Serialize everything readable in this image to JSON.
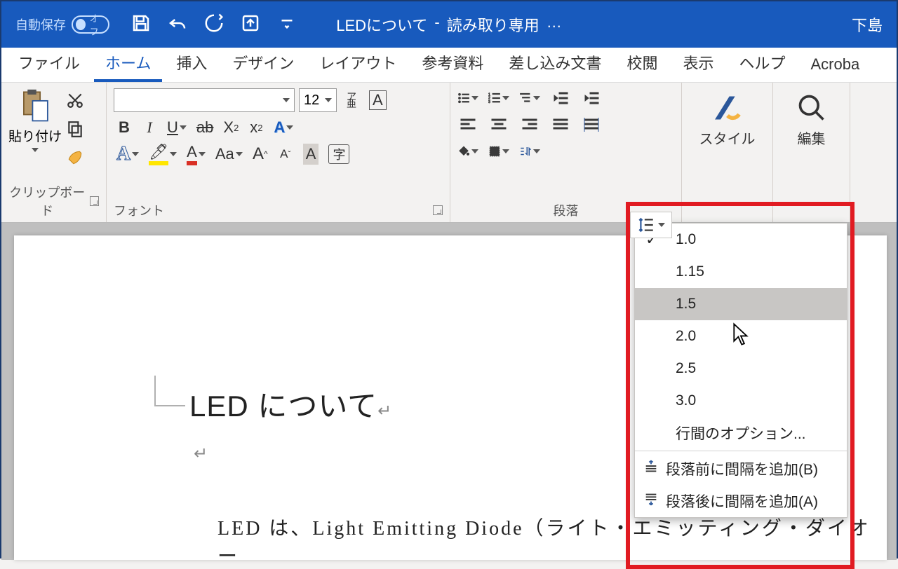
{
  "titlebar": {
    "autosave_label": "自動保存",
    "autosave_state": "オフ",
    "doc_name": "LEDについて",
    "doc_sep": "-",
    "doc_mode": "読み取り専用",
    "ellipsis": "…",
    "user": "下島"
  },
  "tabs": {
    "file": "ファイル",
    "home": "ホーム",
    "insert": "挿入",
    "design": "デザイン",
    "layout": "レイアウト",
    "references": "参考資料",
    "mailings": "差し込み文書",
    "review": "校閲",
    "view": "表示",
    "help": "ヘルプ",
    "acrobat": "Acroba"
  },
  "groups": {
    "clipboard": {
      "label": "クリップボード",
      "paste": "貼り付け"
    },
    "font": {
      "label": "フォント",
      "size": "12",
      "bold": "B",
      "italic": "I",
      "underline": "U",
      "strike": "ab",
      "sub": "X₂",
      "sup": "x²",
      "effects": "A",
      "highlight": "",
      "color": "A",
      "case": "Aa",
      "grow": "A",
      "shrink": "A",
      "shade": "A",
      "enclose": "字"
    },
    "paragraph": {
      "label": "段落"
    },
    "styles": {
      "label": "スタイル"
    },
    "editing": {
      "label": "編集"
    }
  },
  "line_spacing_menu": {
    "items": [
      "1.0",
      "1.15",
      "1.5",
      "2.0",
      "2.5",
      "3.0"
    ],
    "selected": "1.0",
    "hover": "1.5",
    "options": "行間のオプション...",
    "add_before": "段落前に間隔を追加(B)",
    "add_after": "段落後に間隔を追加(A)"
  },
  "document": {
    "title": "LED について",
    "body": "LED は、Light Emitting Diode（ライト・エミッティング・ダイオー"
  }
}
